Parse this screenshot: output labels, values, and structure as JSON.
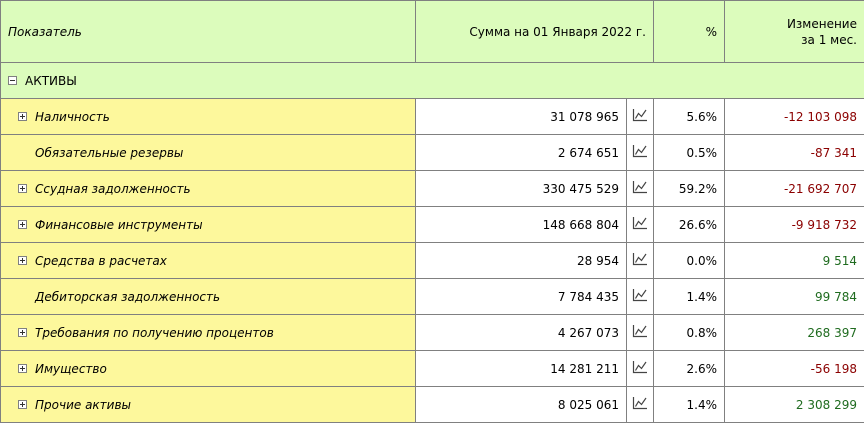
{
  "header": {
    "name": "Показатель",
    "sum": "Сумма на 01 Января 2022 г.",
    "pct": "%",
    "change_line1": "Изменение",
    "change_line2": "за 1 мес."
  },
  "group": {
    "label": "АКТИВЫ",
    "expanded": true
  },
  "icons": {
    "expand": "plus-box-icon",
    "collapse": "minus-box-icon",
    "chart": "line-chart-icon"
  },
  "colors": {
    "header_bg": "#dcfcbc",
    "name_bg": "#fdf89c",
    "negative": "#8b0000",
    "positive": "#1f6b1f"
  },
  "rows": [
    {
      "name": "Наличность",
      "expandable": true,
      "sum": "31 078 965",
      "pct": "5.6%",
      "change": "-12 103 098",
      "sign": "neg"
    },
    {
      "name": "Обязательные резервы",
      "expandable": false,
      "sum": "2 674 651",
      "pct": "0.5%",
      "change": "-87 341",
      "sign": "neg"
    },
    {
      "name": "Ссудная задолженность",
      "expandable": true,
      "sum": "330 475 529",
      "pct": "59.2%",
      "change": "-21 692 707",
      "sign": "neg"
    },
    {
      "name": "Финансовые инструменты",
      "expandable": true,
      "sum": "148 668 804",
      "pct": "26.6%",
      "change": "-9 918 732",
      "sign": "neg"
    },
    {
      "name": "Средства в расчетах",
      "expandable": true,
      "sum": "28 954",
      "pct": "0.0%",
      "change": "9 514",
      "sign": "pos"
    },
    {
      "name": "Дебиторская задолженность",
      "expandable": false,
      "sum": "7 784 435",
      "pct": "1.4%",
      "change": "99 784",
      "sign": "pos"
    },
    {
      "name": "Требования по получению процентов",
      "expandable": true,
      "sum": "4 267 073",
      "pct": "0.8%",
      "change": "268 397",
      "sign": "pos"
    },
    {
      "name": "Имущество",
      "expandable": true,
      "sum": "14 281 211",
      "pct": "2.6%",
      "change": "-56 198",
      "sign": "neg"
    },
    {
      "name": "Прочие активы",
      "expandable": true,
      "sum": "8 025 061",
      "pct": "1.4%",
      "change": "2 308 299",
      "sign": "pos"
    }
  ]
}
